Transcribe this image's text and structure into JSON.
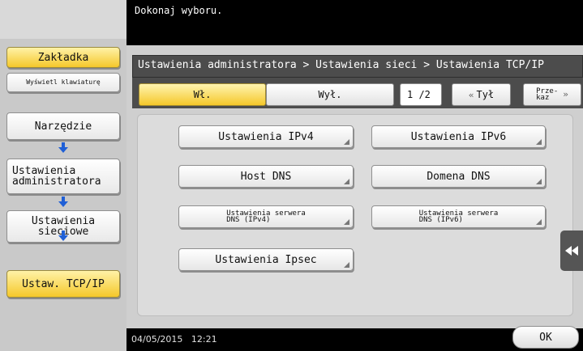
{
  "header": {
    "prompt": "Dokonaj wyboru."
  },
  "sidebar": {
    "bookmark_label": "Zakładka",
    "keyboard_label": "Wyświetl klawiaturę",
    "path": [
      {
        "label": "Narzędzie"
      },
      {
        "label": "Ustawienia administratora"
      },
      {
        "label": "Ustawienia sieciowe"
      },
      {
        "label": "Ustaw. TCP/IP"
      }
    ]
  },
  "breadcrumb": "Ustawienia administratora > Ustawienia sieci > Ustawienia TCP/IP",
  "toolbar": {
    "on_label": "Wł.",
    "off_label": "Wył.",
    "page_indicator": "1 /2",
    "back_label": "Tył",
    "next_label_line1": "Prze-",
    "next_label_line2": "kaz"
  },
  "settings": [
    {
      "label": "Ustawienia IPv4"
    },
    {
      "label": "Ustawienia IPv6"
    },
    {
      "label": "Host DNS"
    },
    {
      "label": "Domena DNS"
    },
    {
      "label_line1": "Ustawienia serwera",
      "label_line2": "DNS (IPv4)"
    },
    {
      "label_line1": "Ustawienia serwera",
      "label_line2": "DNS (IPv6)"
    },
    {
      "label": "Ustawienia Ipsec"
    }
  ],
  "footer": {
    "datetime": "04/05/2015   12:21",
    "ok_label": "OK"
  },
  "colors": {
    "accent_yellow": "#f5c82a",
    "arrow_blue": "#1f5fd6",
    "dark_bar": "#4c4c4c"
  }
}
